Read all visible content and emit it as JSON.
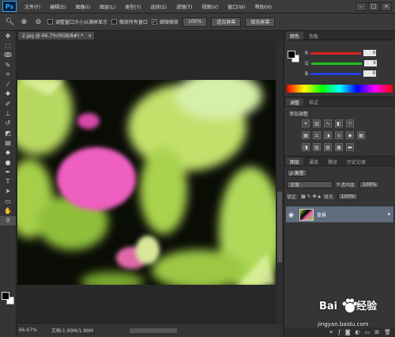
{
  "app": {
    "logo": "Ps"
  },
  "menu": [
    "文件(F)",
    "编辑(E)",
    "图像(I)",
    "图层(L)",
    "类型(Y)",
    "选择(S)",
    "滤镜(T)",
    "视图(V)",
    "窗口(W)",
    "帮助(H)"
  ],
  "window_controls": [
    "–",
    "□",
    "×"
  ],
  "options": {
    "resize_windows": "调整窗口大小以满屏显示",
    "zoom_all": "缩放所有窗口",
    "scrubby_zoom": "细微缩放",
    "btn_100": "100%",
    "btn_fit": "适合屏幕",
    "btn_fill": "填充屏幕"
  },
  "document": {
    "tab": "2.jpg @ 66.7%(RGB/8#) *",
    "close": "×"
  },
  "status": {
    "zoom": "66.67%",
    "doc": "文档:1.99M/1.99M"
  },
  "color_panel": {
    "tabs": [
      "颜色",
      "色板"
    ],
    "sliders": [
      {
        "label": "R",
        "value": "0",
        "color": "#e02020"
      },
      {
        "label": "G",
        "value": "0",
        "color": "#20c020"
      },
      {
        "label": "B",
        "value": "0",
        "color": "#2040e0"
      }
    ]
  },
  "adjustments": {
    "tabs": [
      "调整",
      "样式"
    ],
    "title": "添加调整"
  },
  "layers": {
    "tabs": [
      "图层",
      "通道",
      "路径",
      "历史记录"
    ],
    "kind": "ρ 类型",
    "blend": "正常",
    "opacity_label": "不透明度:",
    "opacity_value": "100%",
    "lock_label": "锁定:",
    "fill_label": "填充:",
    "fill_value": "100%",
    "layer_name": "背景"
  },
  "watermark": {
    "brand": "Bai",
    "suffix": "经验",
    "url": "jingyan.baidu.com"
  }
}
